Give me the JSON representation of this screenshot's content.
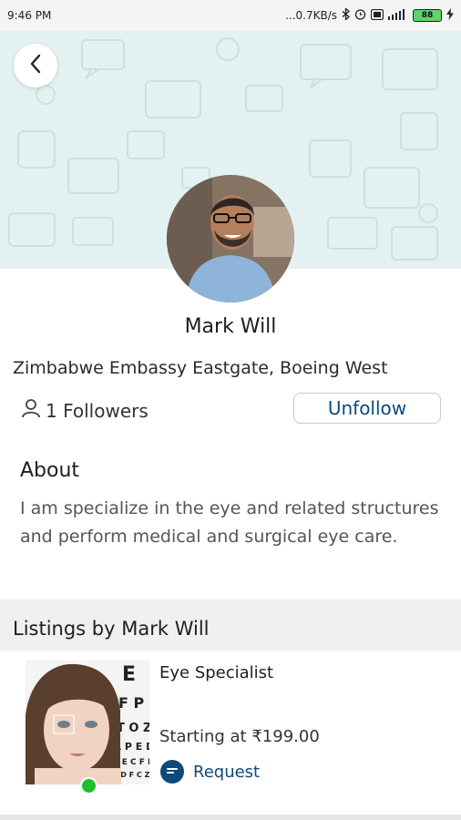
{
  "status_bar": {
    "time": "9:46 PM",
    "network_speed": "...0.7KB/s",
    "battery_level": "88",
    "icons": [
      "bluetooth-icon",
      "alarm-icon",
      "vpn-icon",
      "signal-icon",
      "battery-icon",
      "charging-icon"
    ]
  },
  "header": {
    "back_icon": "chevron-left-icon",
    "cover_pattern_color": "#e4f1f1"
  },
  "profile": {
    "name": "Mark Will",
    "address": "Zimbabwe Embassy Eastgate, Boeing West",
    "followers_icon": "person-icon",
    "followers_text": "1 Followers",
    "unfollow_label": "Unfollow"
  },
  "about": {
    "title": "About",
    "text": "I am specialize in the eye and related structures and perform medical and surgical eye care."
  },
  "listings": {
    "title": "Listings by Mark Will",
    "items": [
      {
        "title": "Eye Specialist",
        "price": "Starting at ₹199.00",
        "action_label": "Request",
        "action_icon": "chat-bubble-icon",
        "online": true
      }
    ]
  },
  "colors": {
    "accent": "#0d4a7a",
    "online": "#1fbf2f",
    "cover": "#e4f1f1",
    "section_band": "#f0f0f0"
  }
}
